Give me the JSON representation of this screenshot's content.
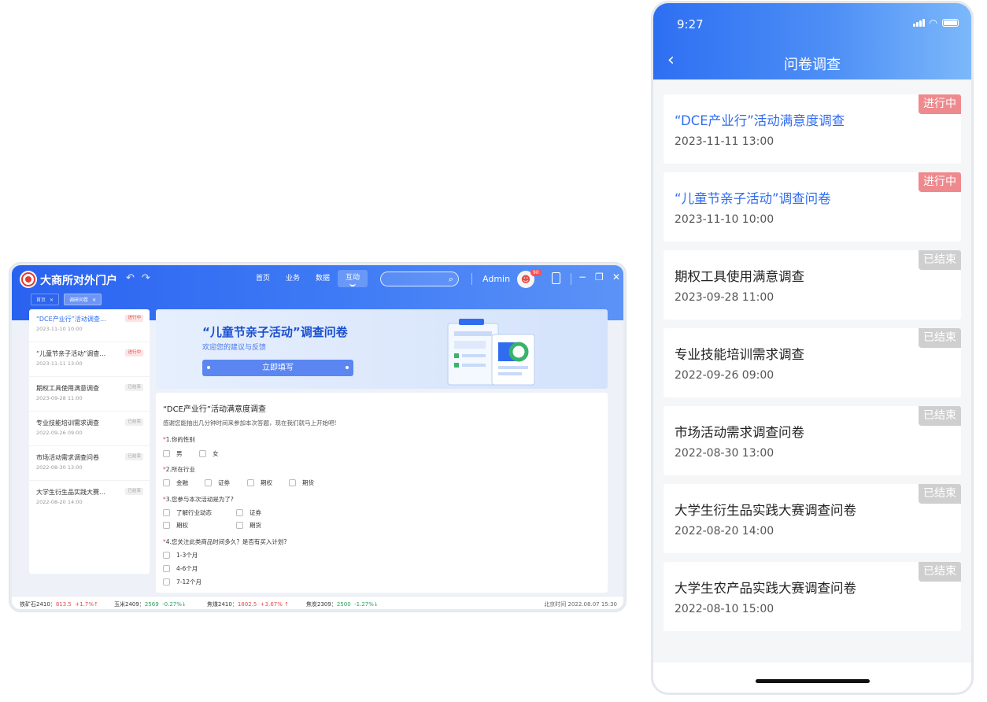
{
  "desktop": {
    "app_title": "大商所对外门户",
    "nav": [
      {
        "label": "首页"
      },
      {
        "label": "业务"
      },
      {
        "label": "数据"
      },
      {
        "label": "互动"
      }
    ],
    "search_placeholder": "",
    "user": "Admin",
    "notif_count": "90",
    "tabs": [
      {
        "label": "首页"
      },
      {
        "label": "调研问卷"
      }
    ],
    "sidebar": [
      {
        "title": "“DCE产业行”活动调查…",
        "date": "2023-11-10  10:00",
        "status": "进行中"
      },
      {
        "title": "“儿童节亲子活动”调查…",
        "date": "2023-11-11  13:00",
        "status": "进行中"
      },
      {
        "title": "期权工具使用满意调查",
        "date": "2023-09-28  11:00",
        "status": "已结束"
      },
      {
        "title": "专业技能培训需求调查",
        "date": "2022-09-26  09:00",
        "status": "已结束"
      },
      {
        "title": "市场活动需求调查问卷",
        "date": "2022-08-30  13:00",
        "status": "已结束"
      },
      {
        "title": "大学生衍生品实践大赛…",
        "date": "2022-08-20  14:00",
        "status": "已结束"
      }
    ],
    "banner": {
      "title": "“儿童节亲子活动”调查问卷",
      "subtitle": "欢迎您的建议与反馈",
      "button": "立即填写"
    },
    "survey": {
      "title": "“DCE产业行”活动满意度调查",
      "desc": "感谢您能抽出几分钟时间来参加本次答题，现在我们就马上开始吧!",
      "q1": {
        "label": "1.你的性别",
        "options": [
          "男",
          "女"
        ]
      },
      "q2": {
        "label": "2.所在行业",
        "options": [
          "金融",
          "证券",
          "期权",
          "期货"
        ]
      },
      "q3": {
        "label": "3.您参与本次活动是为了?",
        "options": [
          "了解行业动态",
          "证券",
          "期权",
          "期货"
        ]
      },
      "q4": {
        "label": "4.您关注此类商品时间多久？是否有买入计划?",
        "options": [
          "1-3个月",
          "4-6个月",
          "7-12个月"
        ]
      }
    },
    "ticker": [
      {
        "name": "铁矿石2410：",
        "price": "813.5",
        "change": "+1.7%↑",
        "dir": "up"
      },
      {
        "name": "玉米2409：",
        "price": "2569",
        "change": "-0.27%↓",
        "dir": "down"
      },
      {
        "name": "焦煤2410：",
        "price": "1802.5",
        "change": "+3.67%  ↑",
        "dir": "up"
      },
      {
        "name": "焦炭2309：",
        "price": "2500",
        "change": "-1.27%↓",
        "dir": "down"
      }
    ],
    "beijing_time": "北京时间 2022.08.07 15:30"
  },
  "mobile": {
    "status_time": "9:27",
    "title": "问卷调查",
    "list": [
      {
        "title": "“DCE产业行”活动满意度调查",
        "date": "2023-11-11  13:00",
        "status": "进行中"
      },
      {
        "title": "“儿童节亲子活动”调查问卷",
        "date": "2023-11-10  10:00",
        "status": "进行中"
      },
      {
        "title": "期权工具使用满意调查",
        "date": "2023-09-28  11:00",
        "status": "已结束"
      },
      {
        "title": "专业技能培训需求调查",
        "date": "2022-09-26  09:00",
        "status": "已结束"
      },
      {
        "title": "市场活动需求调查问卷",
        "date": "2022-08-30  13:00",
        "status": "已结束"
      },
      {
        "title": "大学生衍生品实践大赛调查问卷",
        "date": "2022-08-20  14:00",
        "status": "已结束"
      },
      {
        "title": "大学生农产品实践大赛调查问卷",
        "date": "2022-08-10  15:00",
        "status": "已结束"
      }
    ]
  },
  "colors": {
    "primary": "#2f6cf0",
    "ongoing": "#ee8a8d",
    "ended": "#cfcfcf",
    "up": "#e34c4c",
    "down": "#2aa15a"
  }
}
